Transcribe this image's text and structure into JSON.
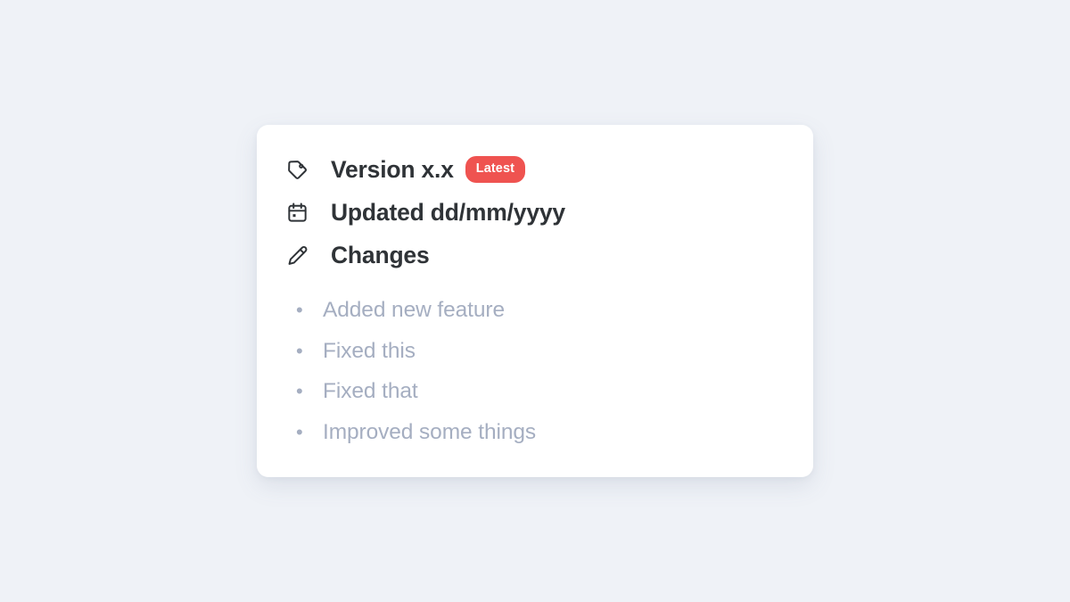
{
  "theme": {
    "page_background": "#eff2f7",
    "card_background": "#ffffff",
    "heading_color": "#2f3337",
    "muted_color": "#a5aec1",
    "badge_color": "#ef5350",
    "badge_text_color": "#ffffff"
  },
  "card": {
    "meta": [
      {
        "icon": "tag-icon",
        "label": "Version x.x",
        "badge": "Latest"
      },
      {
        "icon": "calendar-icon",
        "label": "Updated dd/mm/yyyy"
      },
      {
        "icon": "pencil-icon",
        "label": "Changes"
      }
    ],
    "changes": [
      {
        "text": "Added new feature"
      },
      {
        "text": "Fixed this"
      },
      {
        "text": "Fixed that"
      },
      {
        "text": "Improved some things"
      }
    ]
  }
}
